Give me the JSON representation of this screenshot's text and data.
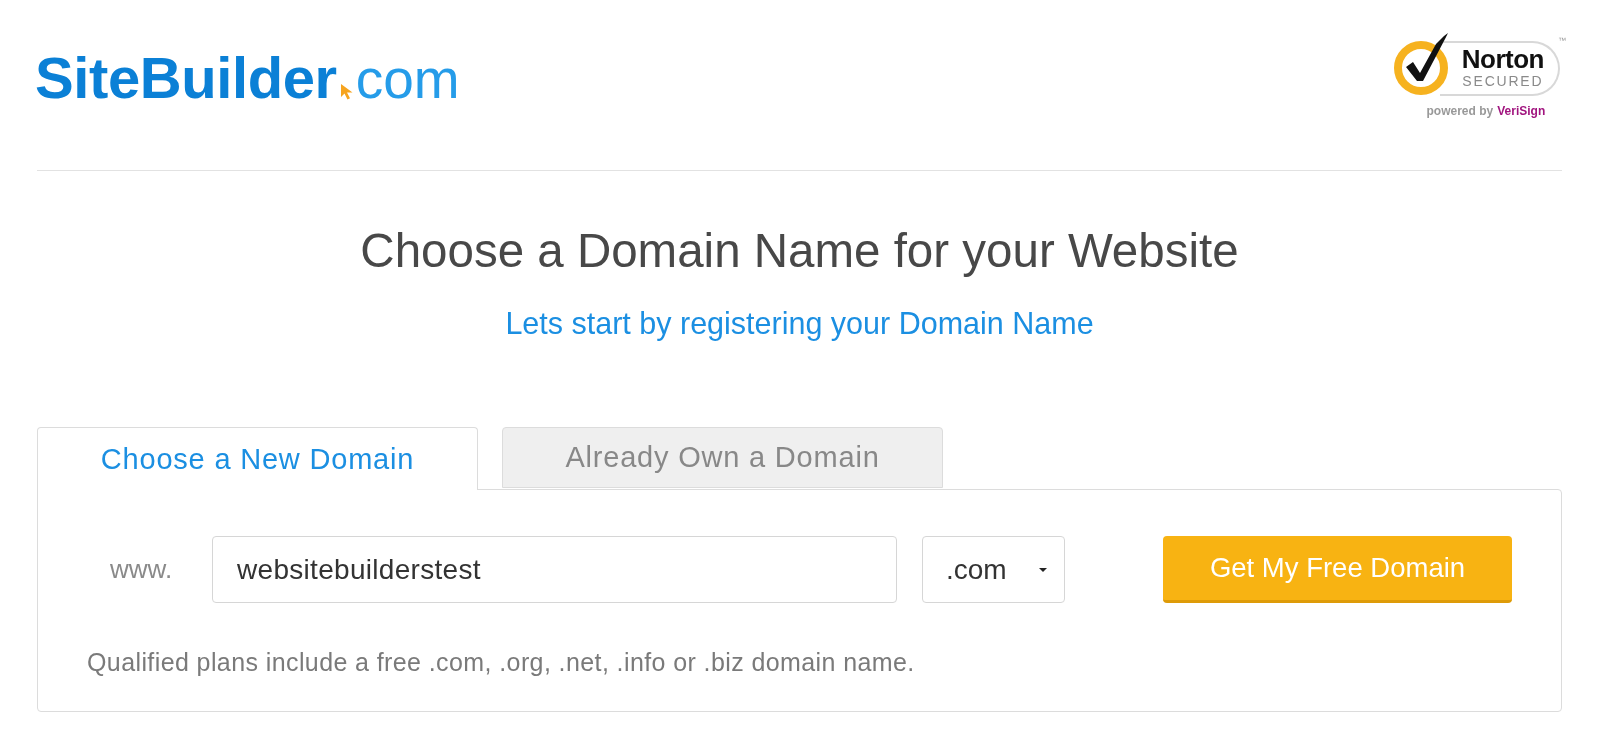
{
  "header": {
    "logo": {
      "brand": "SiteBuilder",
      "suffix": "com"
    },
    "trust_badge": {
      "name": "Norton",
      "status": "SECURED",
      "trademark": "™",
      "powered_by": "powered by",
      "provider": "VeriSign"
    }
  },
  "heading": "Choose a Domain Name for your Website",
  "subheading": "Lets start by registering your Domain Name",
  "tabs": [
    {
      "label": "Choose a New Domain",
      "selected": true
    },
    {
      "label": "Already Own a Domain",
      "selected": false
    }
  ],
  "domain_form": {
    "prefix": "www.",
    "domain_field": {
      "value": "websitebuilderstest"
    },
    "extension_select": {
      "value": ".com"
    },
    "submit_button": "Get My Free Domain",
    "note": "Qualified plans include a free .com, .org, .net, .info or .biz domain name."
  }
}
